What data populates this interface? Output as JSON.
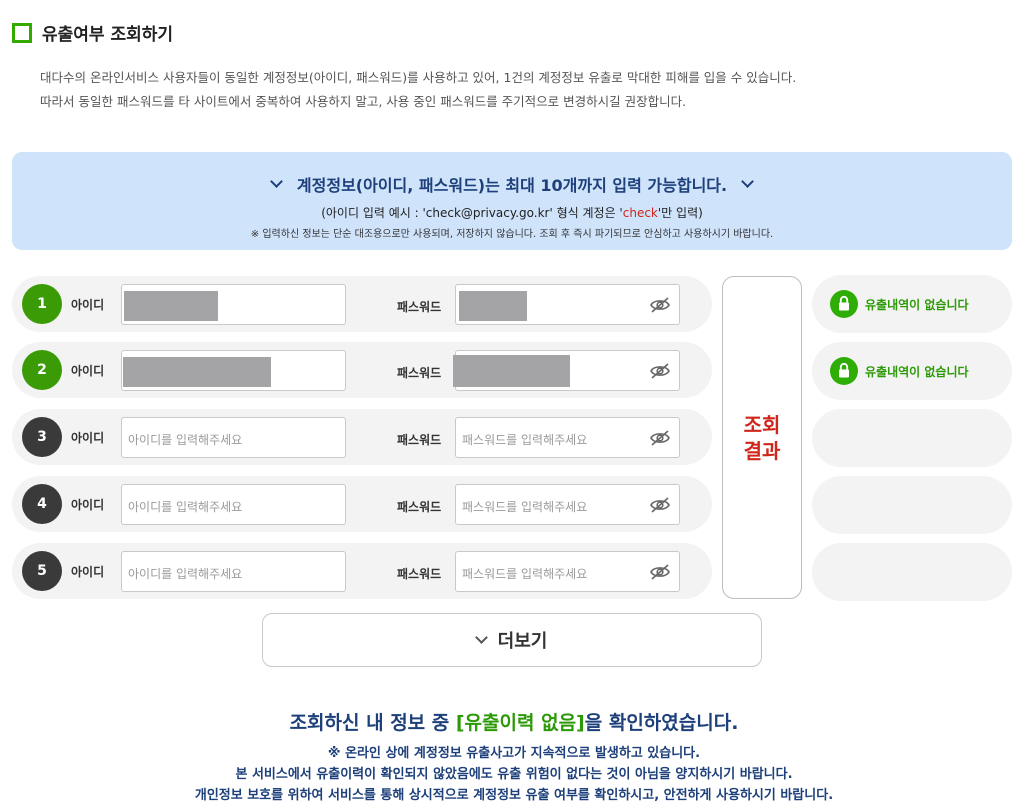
{
  "header": {
    "title": "유출여부 조회하기",
    "desc_line1": "대다수의 온라인서비스 사용자들이 동일한 계정정보(아이디, 패스워드)를 사용하고 있어, 1건의 계정정보 유출로 막대한 피해를 입을 수 있습니다.",
    "desc_line2": "따라서 동일한 패스워드를 타 사이트에서 중복하여 사용하지 말고, 사용 중인 패스워드를 주기적으로 변경하시길 권장합니다."
  },
  "banner": {
    "headline": "계정정보(아이디, 패스워드)는 최대 10개까지 입력 가능합니다.",
    "example_prefix": "(아이디 입력 예시 : 'check@privacy.go.kr' 형식 계정은 '",
    "example_highlight": "check",
    "example_suffix": "'만 입력)",
    "note": "※ 입력하신 정보는 단순 대조용으로만 사용되며, 저장하지 않습니다. 조회 후 즉시 파기되므로 안심하고 사용하시기 바랍니다."
  },
  "form": {
    "id_label": "아이디",
    "pw_label": "패스워드",
    "id_placeholder": "아이디를 입력해주세요",
    "pw_placeholder": "패스워드를 입력해주세요",
    "rows": [
      {
        "num": "1",
        "filled": true
      },
      {
        "num": "2",
        "filled": true
      },
      {
        "num": "3",
        "filled": false
      },
      {
        "num": "4",
        "filled": false
      },
      {
        "num": "5",
        "filled": false
      }
    ]
  },
  "result_button": {
    "label": "조회결과"
  },
  "results": [
    {
      "text": "유출내역이 없습니다"
    },
    {
      "text": "유출내역이 없습니다"
    }
  ],
  "more_button": {
    "label": "더보기"
  },
  "summary": {
    "head_prefix": "조회하신 내 정보 중 ",
    "head_highlight": "[유출이력 없음]",
    "head_suffix": "을 확인하였습니다.",
    "line1": "※ 온라인 상에 계정정보 유출사고가 지속적으로 발생하고 있습니다.",
    "line2": "본 서비스에서 유출이력이 확인되지 않았음에도 유출 위험이 없다는 것이 아님을 양지하시기 바랍니다.",
    "line3": "개인정보 보호를 위하여 서비스를 통해 상시적으로 계정정보 유출 여부를 확인하시고, 안전하게 사용하시기 바랍니다."
  },
  "colors": {
    "accent_green": "#33aa00",
    "navy": "#1d3f7a",
    "red": "#d0261b",
    "banner_bg": "#cfe3fb"
  }
}
